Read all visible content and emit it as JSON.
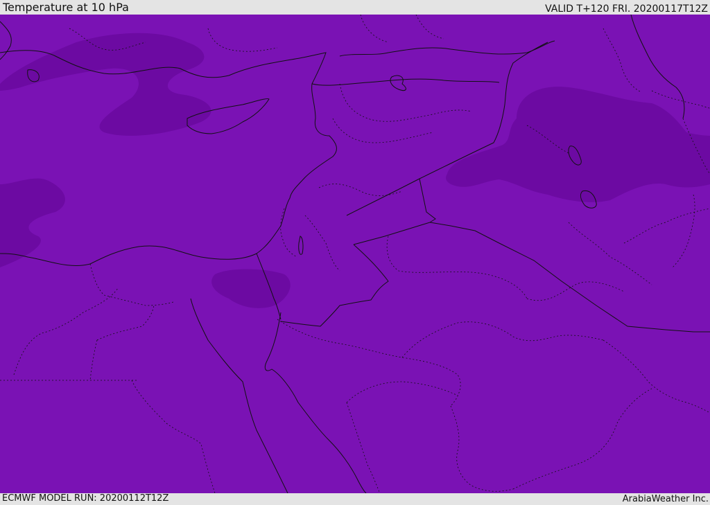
{
  "header": {
    "title": "Temperature at 10 hPa",
    "valid": "VALID T+120 FRI. 20200117T12Z"
  },
  "footer": {
    "model_run": "ECMWF MODEL RUN: 20200112T12Z",
    "credit": "ArabiaWeather Inc."
  },
  "colors": {
    "field": "#7a12b4",
    "cold_field": "#6c0aa2",
    "lines": "#111111",
    "bars": "#e4e4e4"
  }
}
